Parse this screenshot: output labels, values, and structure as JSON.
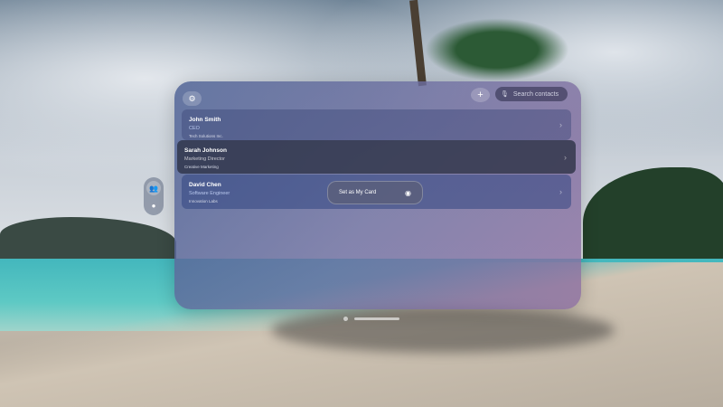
{
  "toolbar": {
    "settings_icon": "gear-icon",
    "add_label": "+",
    "search_placeholder": "Search contacts",
    "mic_icon": "mic-icon"
  },
  "contacts": [
    {
      "name": "John Smith",
      "title": "CEO",
      "company": "Tech Solutions Inc."
    },
    {
      "name": "Sarah Johnson",
      "title": "Marketing Director",
      "company": "Creative Marketing"
    },
    {
      "name": "David Chen",
      "title": "Software Engineer",
      "company": "Innovation Labs"
    }
  ],
  "context_menu": {
    "label": "Set as My Card",
    "icon": "person-crop-circle-icon"
  },
  "chevron": "›",
  "ornament": {
    "items": [
      "contacts-tab",
      "my-card-tab"
    ]
  }
}
